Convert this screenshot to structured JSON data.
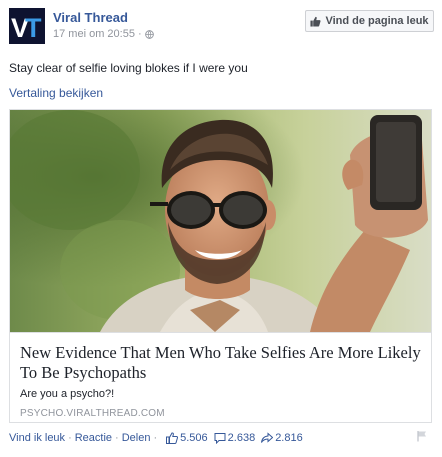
{
  "post": {
    "page_name": "Viral Thread",
    "avatar_text": "VT",
    "timestamp": "17 mei om 20:55",
    "meta_separator": "·",
    "like_page_label": "Vind de pagina leuk",
    "text": "Stay clear of selfie loving blokes if I were you",
    "translate_label": "Vertaling bekijken"
  },
  "link": {
    "title": "New Evidence That Men Who Take Selfies Are More Likely To Be Psychopaths",
    "description": "Are you a psycho?!",
    "domain": "PSYCHO.VIRALTHREAD.COM"
  },
  "actions": {
    "like": "Vind ik leuk",
    "comment": "Reactie",
    "share": "Delen",
    "separator": "·",
    "likes_count": "5.506",
    "comments_count": "2.638",
    "shares_count": "2.816"
  },
  "colors": {
    "link_blue": "#365899",
    "meta_gray": "#90949c",
    "avatar_bg": "#0e1330",
    "avatar_accent": "#3b9be6"
  },
  "icons": [
    "thumbs-up-icon",
    "globe-icon",
    "comment-icon",
    "share-icon",
    "flag-icon"
  ]
}
